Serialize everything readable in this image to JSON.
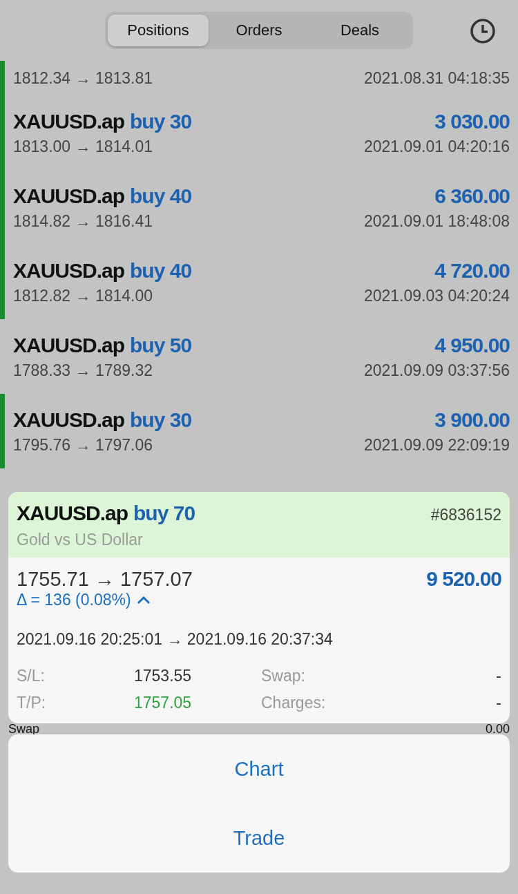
{
  "segments": [
    {
      "label": "Positions",
      "selected": true
    },
    {
      "label": "Orders",
      "selected": false
    },
    {
      "label": "Deals",
      "selected": false
    }
  ],
  "deals": [
    {
      "prices": "1812.34 → 1813.81",
      "time": "2021.08.31 04:18:35",
      "marked": true
    },
    {
      "symbol": "XAUUSD.ap",
      "side": "buy 30",
      "profit": "3 030.00",
      "prices": "1813.00 → 1814.01",
      "time": "2021.09.01 04:20:16",
      "marked": true
    },
    {
      "symbol": "XAUUSD.ap",
      "side": "buy 40",
      "profit": "6 360.00",
      "prices": "1814.82 → 1816.41",
      "time": "2021.09.01 18:48:08",
      "marked": true
    },
    {
      "symbol": "XAUUSD.ap",
      "side": "buy 40",
      "profit": "4 720.00",
      "prices": "1812.82 → 1814.00",
      "time": "2021.09.03 04:20:24",
      "marked": true
    },
    {
      "symbol": "XAUUSD.ap",
      "side": "buy 50",
      "profit": "4 950.00",
      "prices": "1788.33 → 1789.32",
      "time": "2021.09.09 03:37:56",
      "marked": false
    },
    {
      "symbol": "XAUUSD.ap",
      "side": "buy 30",
      "profit": "3 900.00",
      "prices": "1795.76 → 1797.06",
      "time": "2021.09.09 22:09:19",
      "marked": true
    }
  ],
  "detail": {
    "symbol": "XAUUSD.ap",
    "side": "buy 70",
    "ticket": "#6836152",
    "description": "Gold vs US Dollar",
    "prices": "1755.71 → 1757.07",
    "profit": "9 520.00",
    "delta": "Δ = 136 (0.08%)",
    "expanded": true,
    "times": "2021.09.16 20:25:01 → 2021.09.16 20:37:34",
    "fields": [
      {
        "label": "S/L:",
        "value": "1753.55",
        "kind": "plain"
      },
      {
        "label": "Swap:",
        "value": "-",
        "kind": "plain"
      },
      {
        "label": "T/P:",
        "value": "1757.05",
        "kind": "positive"
      },
      {
        "label": "Charges:",
        "value": "-",
        "kind": "plain"
      }
    ]
  },
  "behind_row": {
    "label": "Swap",
    "value": "0.00"
  },
  "actions": [
    "Chart",
    "Trade"
  ]
}
